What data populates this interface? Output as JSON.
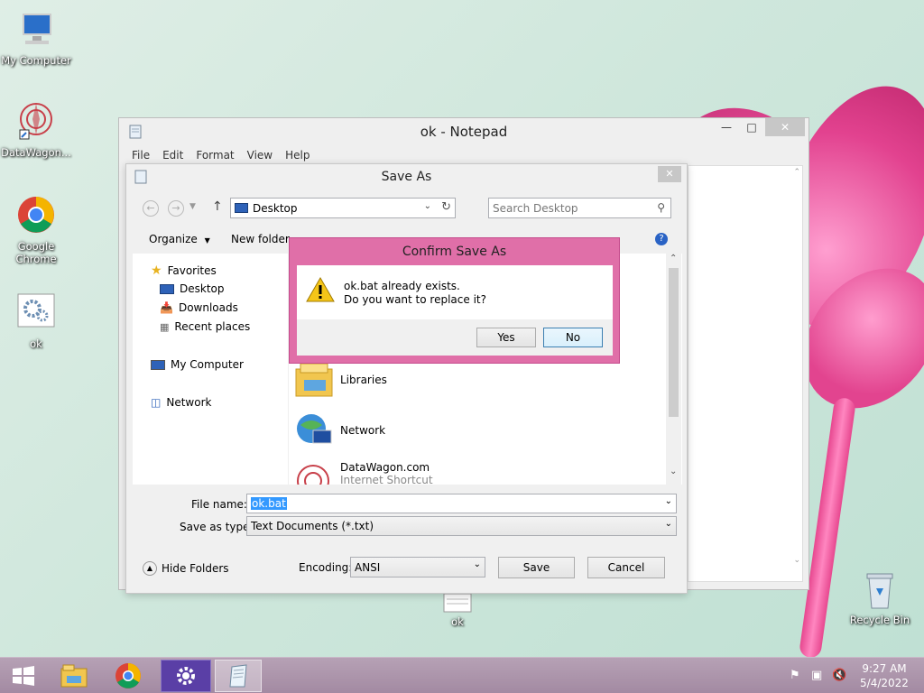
{
  "desktop": {
    "icons": [
      {
        "label": "My Computer"
      },
      {
        "label": "DataWagon..."
      },
      {
        "label": "Google Chrome"
      },
      {
        "label": "ok"
      },
      {
        "label": "ok"
      },
      {
        "label": "Recycle Bin"
      }
    ]
  },
  "notepad": {
    "title": "ok - Notepad",
    "menu": [
      "File",
      "Edit",
      "Format",
      "View",
      "Help"
    ]
  },
  "save_as": {
    "title": "Save As",
    "address": "Desktop",
    "search_placeholder": "Search Desktop",
    "organize_label": "Organize",
    "new_folder_label": "New folder",
    "tree": {
      "favorites": "Favorites",
      "desktop": "Desktop",
      "downloads": "Downloads",
      "recent": "Recent places",
      "my_computer": "My Computer",
      "network": "Network"
    },
    "files": [
      {
        "name": "Libraries",
        "sub": ""
      },
      {
        "name": "Network",
        "sub": ""
      },
      {
        "name": "DataWagon.com",
        "sub": "Internet Shortcut"
      }
    ],
    "file_name_label": "File name:",
    "file_name_value": "ok.bat",
    "save_as_type_label": "Save as type:",
    "save_as_type_value": "Text Documents (*.txt)",
    "hide_folders_label": "Hide Folders",
    "encoding_label": "Encoding:",
    "encoding_value": "ANSI",
    "save_label": "Save",
    "cancel_label": "Cancel"
  },
  "confirm": {
    "title": "Confirm Save As",
    "line1": "ok.bat already exists.",
    "line2": "Do you want to replace it?",
    "yes_label": "Yes",
    "no_label": "No"
  },
  "taskbar": {
    "time": "9:27 AM",
    "date": "5/4/2022"
  },
  "colors": {
    "taskbar": "#a38aa2",
    "confirm_frame": "#e06fa8",
    "accent": "#3399ff"
  }
}
